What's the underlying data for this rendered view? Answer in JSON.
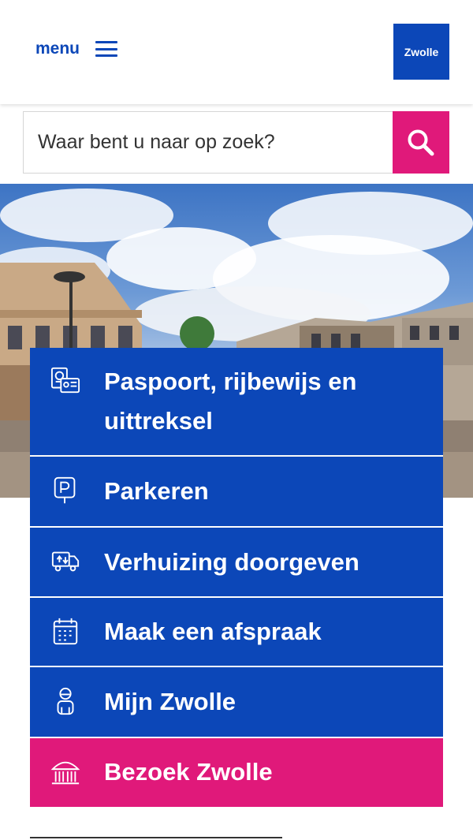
{
  "header": {
    "menu_label": "menu",
    "logo_text": "Zwolle"
  },
  "search": {
    "placeholder": "Waar bent u naar op zoek?"
  },
  "tiles": [
    {
      "label": "Paspoort, rijbewijs en uittreksel",
      "icon": "id-card-icon"
    },
    {
      "label": "Parkeren",
      "icon": "parking-sign-icon"
    },
    {
      "label": "Verhuizing doorgeven",
      "icon": "moving-truck-icon"
    },
    {
      "label": "Maak een afspraak",
      "icon": "calendar-icon"
    },
    {
      "label": "Mijn Zwolle",
      "icon": "person-icon"
    },
    {
      "label": "Bezoek Zwolle",
      "icon": "building-icon"
    }
  ],
  "colors": {
    "brand_blue": "#0c47b8",
    "accent_pink": "#e0197a"
  }
}
